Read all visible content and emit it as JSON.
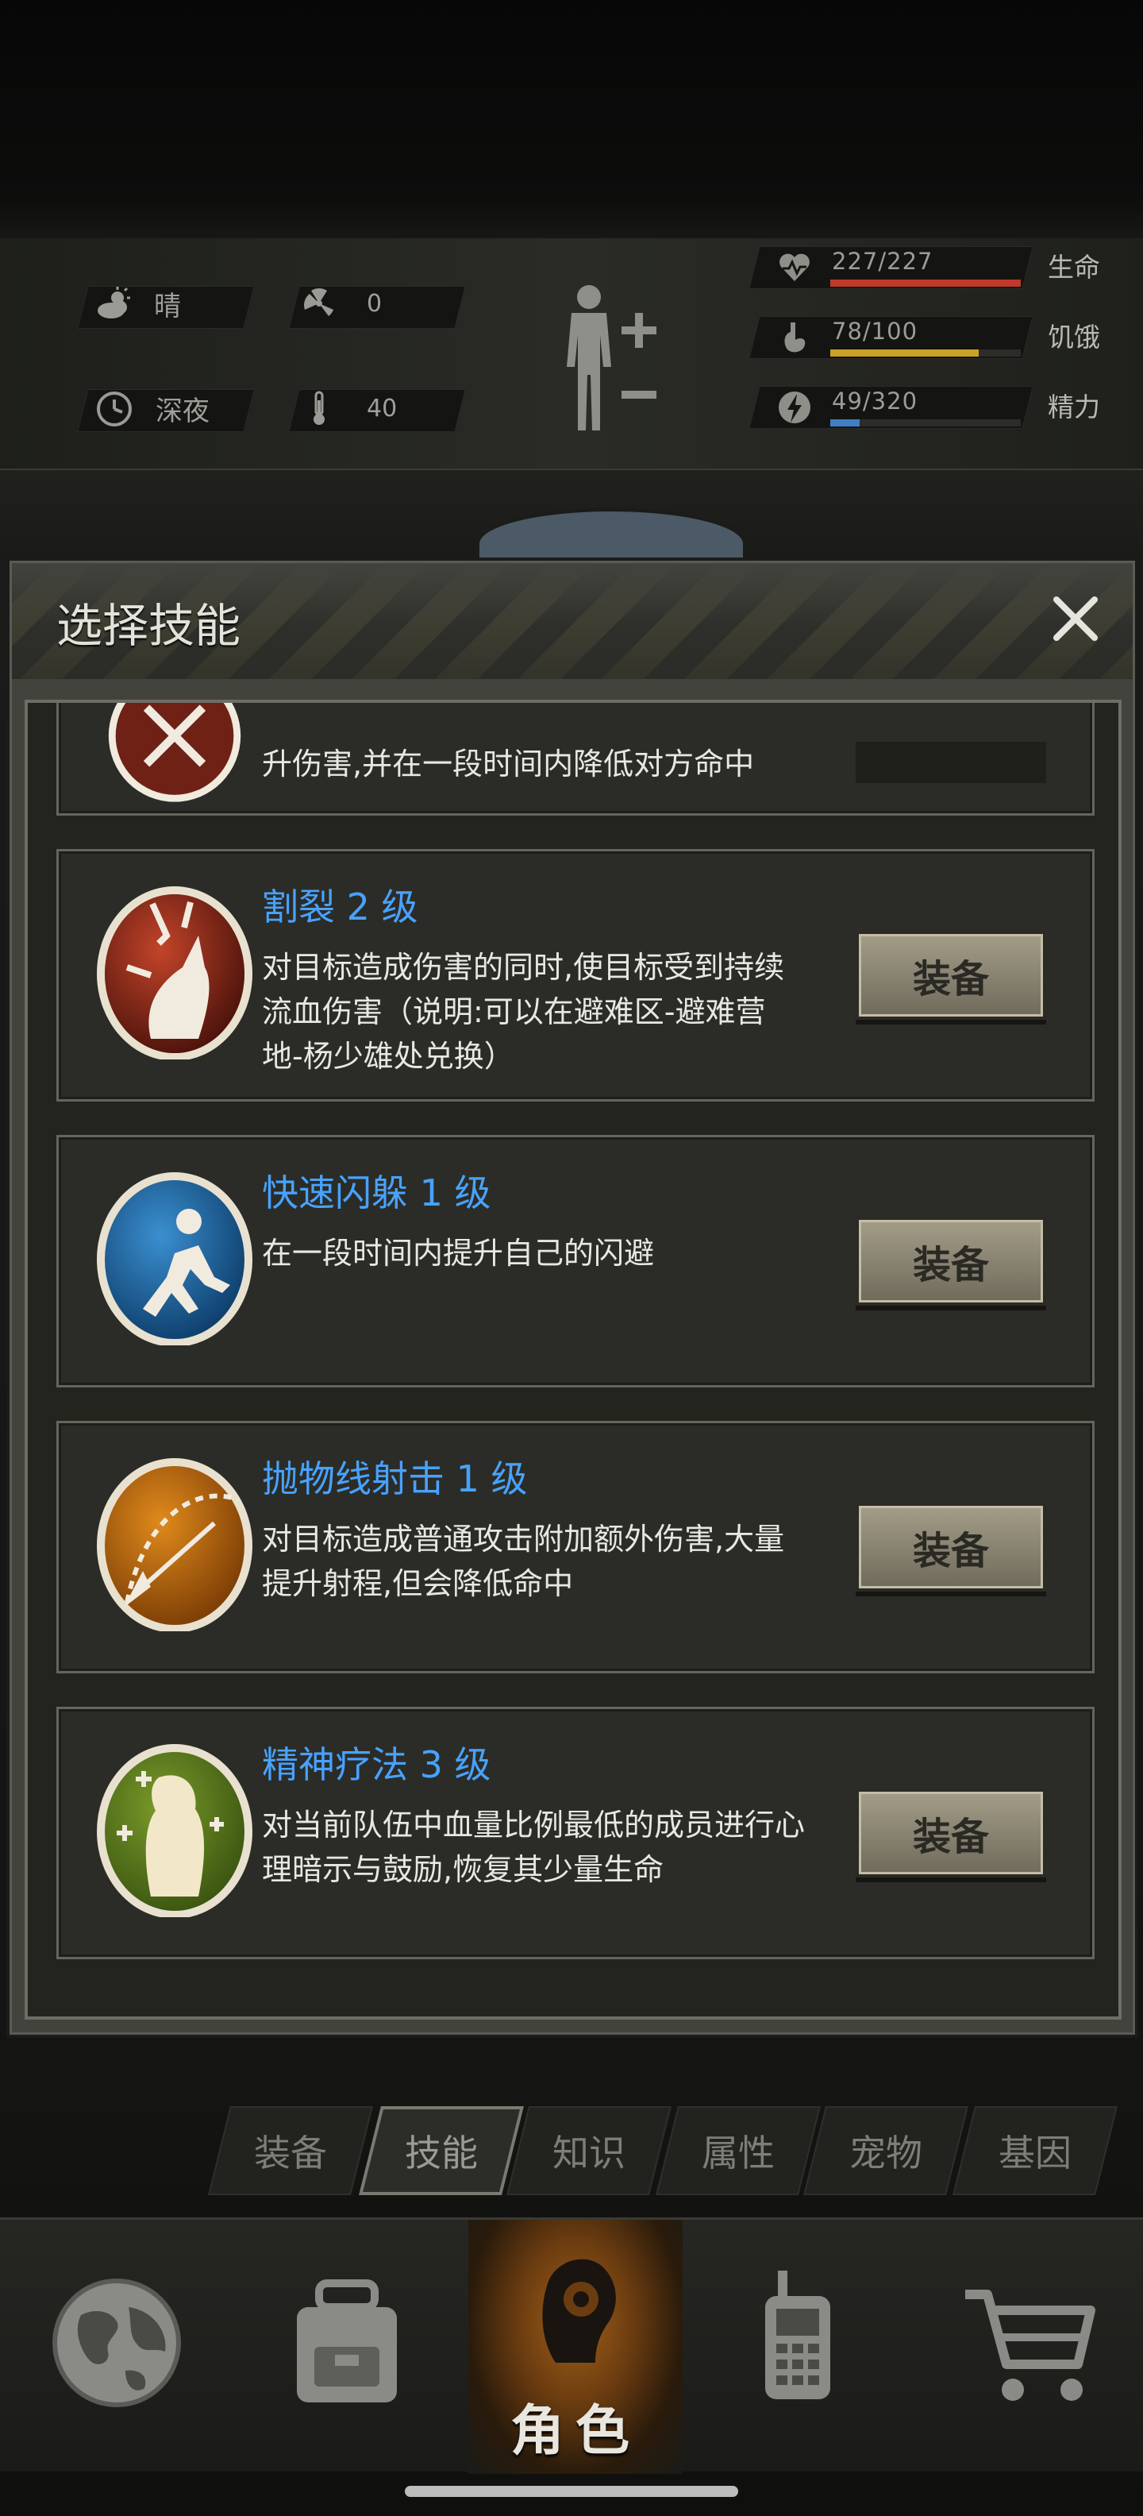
{
  "hud": {
    "weather": "晴",
    "radiation": "0",
    "time_of_day": "深夜",
    "temperature": "40",
    "stats": [
      {
        "value": "227/227",
        "label": "生命",
        "fill": 1.0,
        "color": "#c0392b"
      },
      {
        "value": "78/100",
        "label": "饥饿",
        "fill": 0.78,
        "color": "#c9a227"
      },
      {
        "value": "49/320",
        "label": "精力",
        "fill": 0.153,
        "color": "#3f7fc4"
      }
    ],
    "icons": [
      "sun-cloud-icon",
      "radiation-icon",
      "clock-icon",
      "thermometer-icon",
      "body-plus-minus-icon",
      "heart-icon",
      "stomach-icon",
      "lightning-icon"
    ]
  },
  "modal": {
    "title": "选择技能",
    "close_icon": "close-icon",
    "partial_skill_desc": "升伤害,并在一段时间内降低对方命中",
    "skills": [
      {
        "name": "割裂 2 级",
        "desc_lines": [
          "对目标造成伤害的同时,使目标受到持续",
          "流血伤害（说明:可以在避难区-避难营",
          "地-杨少雄处兑换）"
        ],
        "button": "装备",
        "icon": "bleed-claw-icon"
      },
      {
        "name": "快速闪躲 1 级",
        "desc_lines": [
          "在一段时间内提升自己的闪避"
        ],
        "button": "装备",
        "icon": "dodge-icon"
      },
      {
        "name": "抛物线射击 1 级",
        "desc_lines": [
          "对目标造成普通攻击附加额外伤害,大量",
          "提升射程,但会降低命中"
        ],
        "button": "装备",
        "icon": "parabolic-shot-icon"
      },
      {
        "name": "精神疗法 3 级",
        "desc_lines": [
          "对当前队伍中血量比例最低的成员进行心",
          "理暗示与鼓励,恢复其少量生命"
        ],
        "button": "装备",
        "icon": "mental-therapy-icon"
      }
    ]
  },
  "tabs": {
    "items": [
      "装备",
      "技能",
      "知识",
      "属性",
      "宠物",
      "基因"
    ],
    "active": "技能"
  },
  "bottom_nav": {
    "items": [
      {
        "icon": "globe-icon"
      },
      {
        "icon": "backpack-icon"
      },
      {
        "icon": "character-head-icon",
        "label": "角色"
      },
      {
        "icon": "walkie-talkie-icon"
      },
      {
        "icon": "shopping-cart-icon"
      }
    ]
  }
}
